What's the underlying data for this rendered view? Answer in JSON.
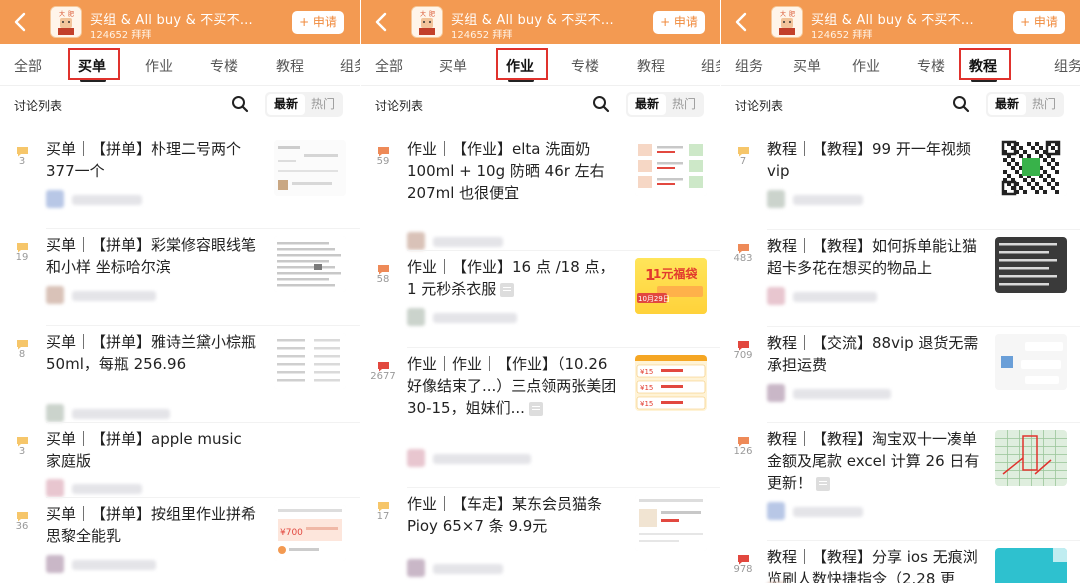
{
  "colors": {
    "header": "#f39a52",
    "redbox": "#e0322d",
    "bubble_yellow": "#f6c66a",
    "bubble_orange": "#ee8a58",
    "bubble_red": "#e2483f"
  },
  "panels": [
    {
      "header": {
        "title": "买组 & All buy & 不买不...",
        "subtitle": "124652 拜拜",
        "apply": "+ 申请"
      },
      "tabs": [
        "全部",
        "买单",
        "作业",
        "专楼",
        "教程",
        "组务"
      ],
      "active_tab": 1,
      "list_title": "讨论列表",
      "seg": [
        "最新",
        "热门"
      ],
      "items": [
        {
          "count": "3",
          "text": "买单｜【拼单】朴理二号两个377一个",
          "bubble": "yellow",
          "thumb": "doc"
        },
        {
          "count": "19",
          "text": "买单｜【拼单】彩棠修容眼线笔和小样 坐标哈尔滨",
          "bubble": "yellow",
          "thumb": "text"
        },
        {
          "count": "8",
          "text": "买单｜【拼单】雅诗兰黛小棕瓶 50ml，每瓶 256.96",
          "bubble": "yellow",
          "thumb": "table"
        },
        {
          "count": "3",
          "text": "买单｜【拼单】apple music 家庭版",
          "bubble": "yellow",
          "thumb": "none"
        },
        {
          "count": "36",
          "text": "买单｜【拼单】按组里作业拼希思黎全能乳",
          "bubble": "yellow",
          "thumb": "coupon"
        }
      ]
    },
    {
      "header": {
        "title": "买组 & All buy & 不买不...",
        "subtitle": "124652 拜拜",
        "apply": "+ 申请"
      },
      "tabs": [
        "全部",
        "买单",
        "作业",
        "专楼",
        "教程",
        "组务"
      ],
      "active_tab": 2,
      "list_title": "讨论列表",
      "seg": [
        "最新",
        "热门"
      ],
      "items": [
        {
          "count": "59",
          "text": "作业｜【作业】elta 洗面奶 100ml + 10g 防晒 46r 左右 207ml 也很便宜",
          "bubble": "orange",
          "thumb": "shop",
          "note": false
        },
        {
          "count": "58",
          "text": "作业｜【作业】16 点 /18 点，1 元秒杀衣服",
          "bubble": "orange",
          "thumb": "yellow",
          "note": true,
          "thumb_big": "1元福袋",
          "thumb_tag": "10月29日"
        },
        {
          "count": "2677",
          "text": "作业｜作业｜【作业】（10.26 好像结束了...）三点领两张美团 30-15，姐妹们...",
          "bubble": "red",
          "thumb": "meituan",
          "note": true
        },
        {
          "count": "17",
          "text": "作业｜【车走】某东会员猫条 Pioy 65×7 条 9.9元",
          "bubble": "yellow",
          "thumb": "product",
          "note": false
        }
      ]
    },
    {
      "header": {
        "title": "买组 & All buy & 不买不...",
        "subtitle": "124652 拜拜",
        "apply": "+ 申请"
      },
      "tabs": [
        "组务",
        "买单",
        "作业",
        "专楼",
        "教程",
        "组务"
      ],
      "active_tab": 4,
      "list_title": "讨论列表",
      "seg": [
        "最新",
        "热门"
      ],
      "items": [
        {
          "count": "7",
          "text": "教程｜【教程】99 开一年视频 vip",
          "bubble": "yellow",
          "thumb": "qr",
          "note": false
        },
        {
          "count": "483",
          "text": "教程｜【教程】如何拆单能让猫超卡多花在想买的物品上",
          "bubble": "orange",
          "thumb": "darktext",
          "note": false
        },
        {
          "count": "709",
          "text": "教程｜【交流】88vip 退货无需承担运费",
          "bubble": "red",
          "thumb": "chat",
          "note": false
        },
        {
          "count": "126",
          "text": "教程｜【教程】淘宝双十一凑单金额及尾款 excel 计算 26 日有更新！",
          "bubble": "orange",
          "thumb": "sheet",
          "note": true
        },
        {
          "count": "978",
          "text": "教程｜【教程】分享 ios 无痕浏览刷人数快捷指令（2.28 更",
          "bubble": "red",
          "thumb": "teal",
          "note": false
        }
      ]
    }
  ]
}
